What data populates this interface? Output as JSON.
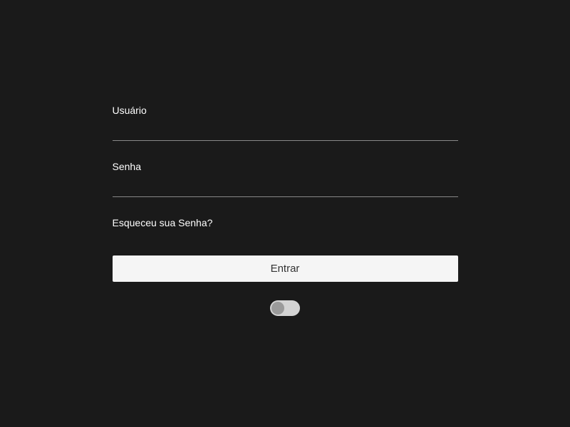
{
  "form": {
    "username_label": "Usuário",
    "username_value": "",
    "password_label": "Senha",
    "password_value": "",
    "forgot_password_text": "Esqueceu sua Senha?",
    "submit_label": "Entrar",
    "toggle_state": "off"
  }
}
